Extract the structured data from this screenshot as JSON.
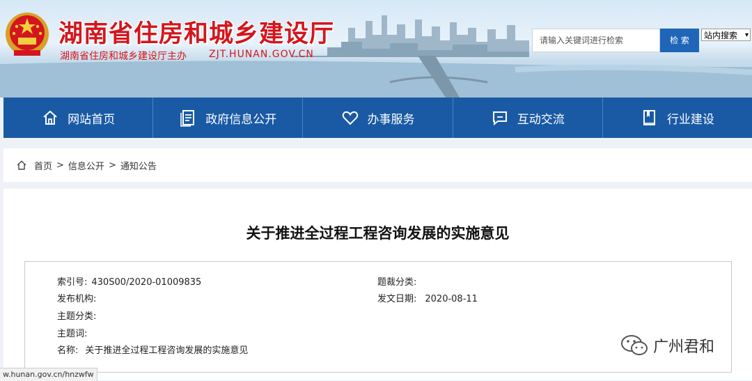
{
  "header": {
    "title": "湖南省住房和城乡建设厅",
    "subtitle": "湖南省住房和城乡建设厅主办",
    "url": "ZJT.HUNAN.GOV.CN",
    "emblem_icon": "national-emblem",
    "title_color": "#d3161d"
  },
  "search": {
    "placeholder": "请输入关键词进行检索",
    "button_label": "检 索",
    "scope_selected": "站内搜索"
  },
  "nav": {
    "items": [
      {
        "label": "网站首页",
        "icon": "home-icon"
      },
      {
        "label": "政府信息公开",
        "icon": "document-icon"
      },
      {
        "label": "办事服务",
        "icon": "heart-icon"
      },
      {
        "label": "互动交流",
        "icon": "chat-icon"
      },
      {
        "label": "行业建设",
        "icon": "book-icon"
      }
    ],
    "color": "#1a5aa5"
  },
  "breadcrumb": {
    "items": [
      "首页",
      "信息公开",
      "通知公告"
    ],
    "separator": ">"
  },
  "article": {
    "title": "关于推进全过程工程咨询发展的实施意见",
    "meta": {
      "index_label": "索引号:",
      "index_value": "430S00/2020-01009835",
      "category_label": "题裁分类:",
      "category_value": "",
      "publisher_label": "发布机构:",
      "publisher_value": "",
      "date_label": "发文日期:",
      "date_value": "2020-08-11",
      "topic_label": "主题分类:",
      "topic_value": "",
      "keywords_label": "主题词:",
      "keywords_value": "",
      "name_label": "名称:",
      "name_value": "关于推进全过程工程咨询发展的实施意见"
    }
  },
  "watermark": {
    "text": "广州君和",
    "icon": "wechat-icon"
  },
  "status_bar": {
    "url": "w.hunan.gov.cn/hnzwfw"
  }
}
